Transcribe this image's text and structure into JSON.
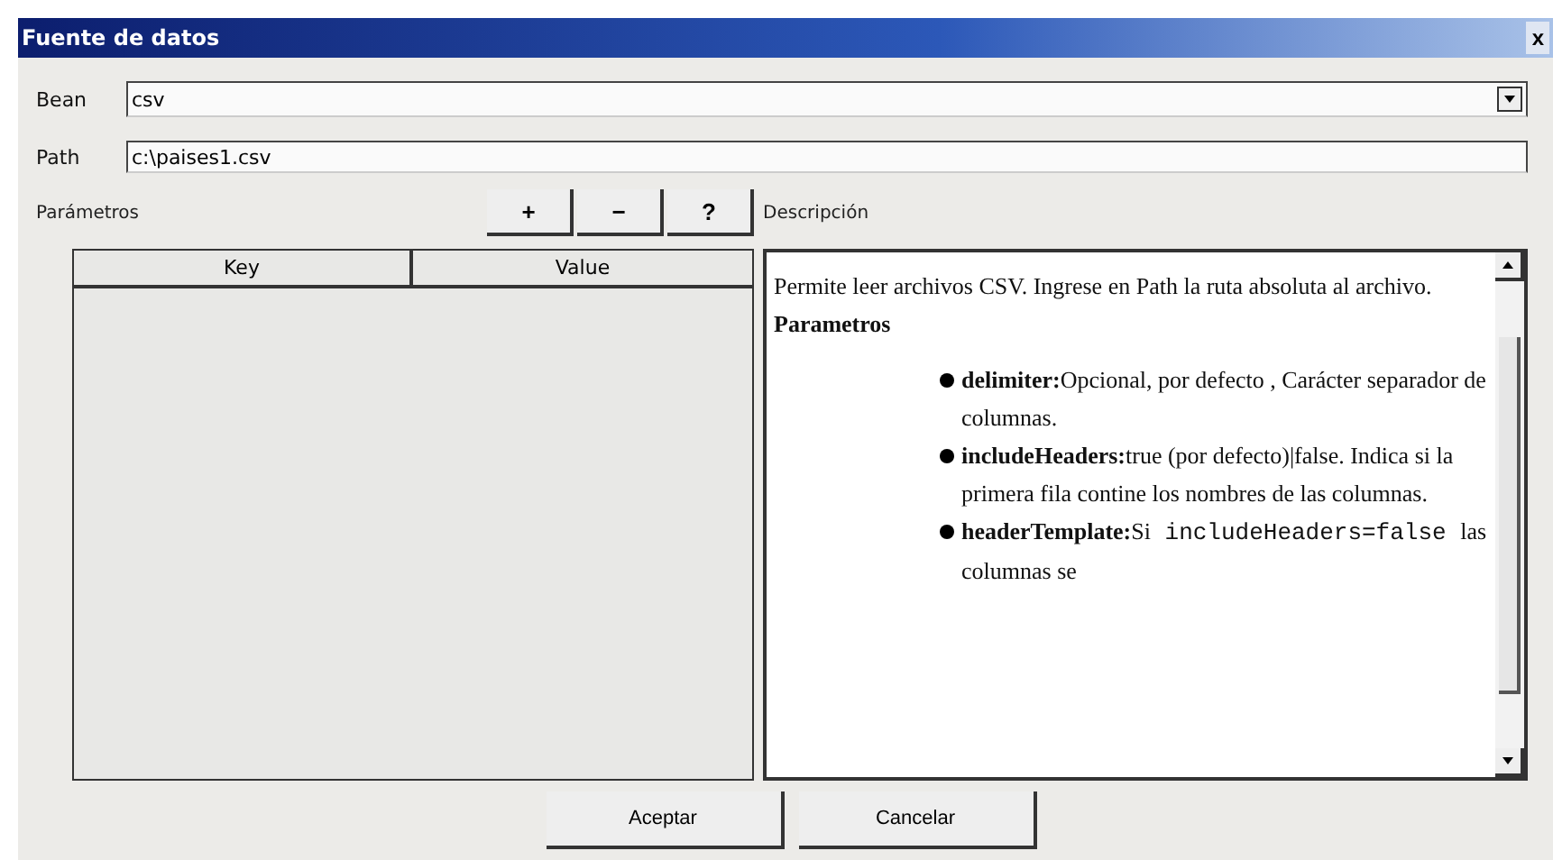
{
  "window": {
    "title": "Fuente de datos",
    "close": "x"
  },
  "bean": {
    "label": "Bean",
    "value": "csv"
  },
  "path": {
    "label": "Path",
    "value": "c:\\paises1.csv"
  },
  "parameters": {
    "label": "Parámetros",
    "buttons": [
      "+",
      "−",
      "?"
    ],
    "table": {
      "columns": [
        "Key",
        "Value"
      ]
    }
  },
  "description": {
    "label": "Descripción",
    "intro": "Permite leer archivos CSV. Ingrese en Path la ruta absoluta al archivo.",
    "heading": "Parametros",
    "items": [
      {
        "term": "delimiter:",
        "parts": [
          {
            "kind": "text",
            "text": "Opcional, por defecto , Carácter separador de columnas."
          }
        ]
      },
      {
        "term": "includeHeaders:",
        "parts": [
          {
            "kind": "text",
            "text": "true (por defecto)|false. Indica si la primera fila contine los nombres de las columnas."
          }
        ]
      },
      {
        "term": "headerTemplate:",
        "parts": [
          {
            "kind": "text",
            "text": "Si"
          },
          {
            "kind": "code",
            "text": "includeHeaders=false"
          },
          {
            "kind": "text",
            "text": "las columnas se"
          }
        ]
      }
    ]
  },
  "buttons": [
    "Aceptar",
    "Cancelar"
  ]
}
